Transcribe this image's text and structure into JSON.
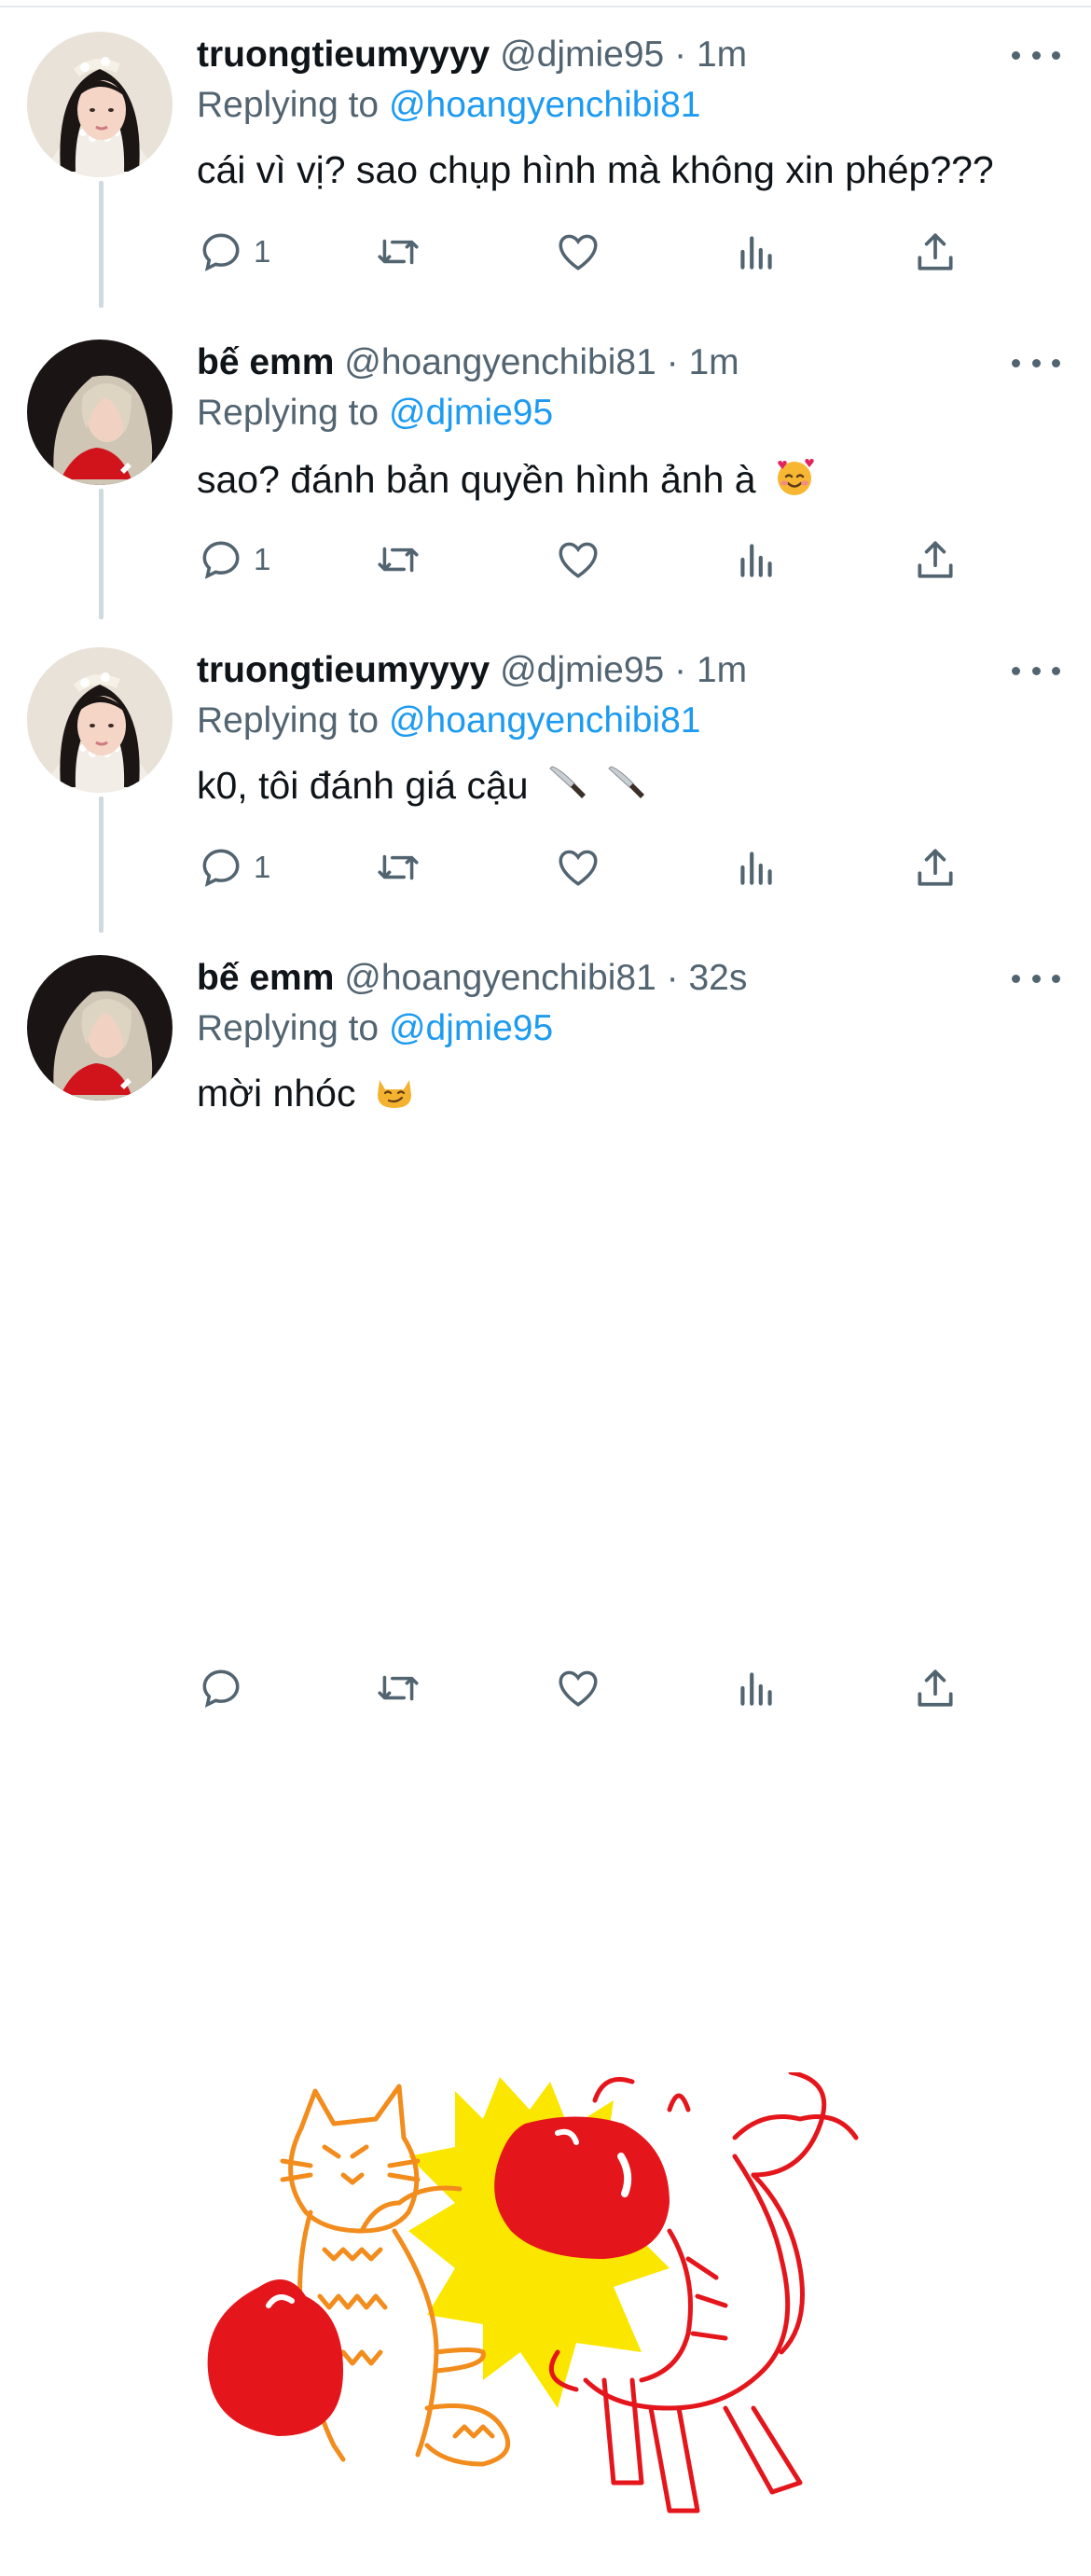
{
  "tweets": [
    {
      "name": "truongtieumyyyy",
      "handle": "@djmie95",
      "dot": "·",
      "time": "1m",
      "replying_prefix": "Replying to",
      "replying_to": "@hoangyenchibi81",
      "text": "cái vì vị? sao chụp hình mà không xin phép???",
      "reply_count": "1"
    },
    {
      "name": "bế emm",
      "handle": "@hoangyenchibi81",
      "dot": "·",
      "time": "1m",
      "replying_prefix": "Replying to",
      "replying_to": "@djmie95",
      "text": "sao? đánh bản quyền hình ảnh à",
      "emoji": "smiling-face-with-hearts",
      "reply_count": "1"
    },
    {
      "name": "truongtieumyyyy",
      "handle": "@djmie95",
      "dot": "·",
      "time": "1m",
      "replying_prefix": "Replying to",
      "replying_to": "@hoangyenchibi81",
      "text": "k0, tôi đánh giá cậu",
      "emoji": "knife",
      "reply_count": "1"
    },
    {
      "name": "bế emm",
      "handle": "@hoangyenchibi81",
      "dot": "·",
      "time": "32s",
      "replying_prefix": "Replying to",
      "replying_to": "@djmie95",
      "text": "mời nhóc",
      "emoji": "smirking-cat",
      "reply_count": ""
    }
  ],
  "icons": [
    "reply-icon",
    "retweet-icon",
    "like-icon",
    "analytics-icon",
    "share-icon",
    "more-icon"
  ],
  "colors": {
    "link": "#1d9bf0",
    "secondary_text": "#536471",
    "primary_text": "#0f1419",
    "thread_line": "#cfd9de"
  }
}
